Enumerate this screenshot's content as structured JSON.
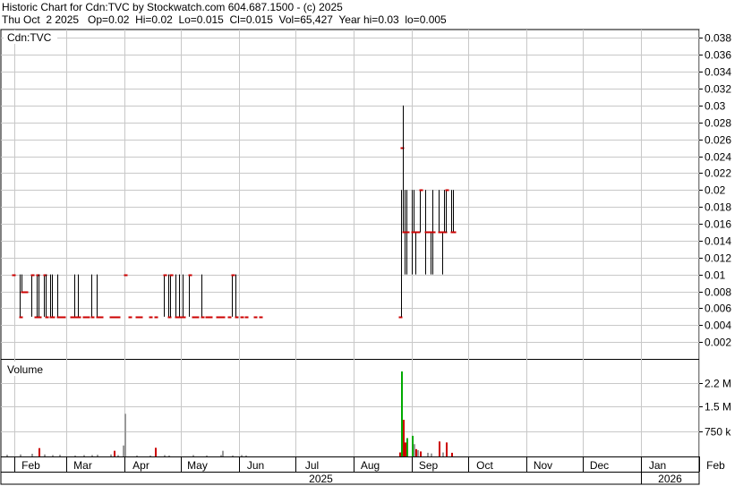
{
  "header": {
    "line1": "Historic Chart for Cdn:TVC by Stockwatch.com 604.687.1500 - (c) 2025",
    "line2": "Thu Oct  2 2025   Op=0.02  Hi=0.02  Lo=0.015  Cl=0.015  Vol=65,427  Year hi=0.03  lo=0.005"
  },
  "colors": {
    "up": "#00aa00",
    "down": "#cc0000",
    "neutral": "#999999",
    "bar": "#000000",
    "grid": "#c8c8c8"
  },
  "chart_data": [
    {
      "type": "line",
      "title": "Cdn:TVC",
      "ylim": [
        0,
        0.039
      ],
      "yticks": [
        "0.038",
        "0.036",
        "0.034",
        "0.032",
        "0.03",
        "0.028",
        "0.026",
        "0.024",
        "0.022",
        "0.02",
        "0.018",
        "0.016",
        "0.014",
        "0.012",
        "0.01",
        "0.008",
        "0.006",
        "0.004",
        "0.002"
      ],
      "series": [
        {
          "style": "hlc-bars",
          "x": [
            "2025-01-31",
            "2025-02-04",
            "2025-02-05",
            "2025-02-07",
            "2025-02-10",
            "2025-02-12",
            "2025-02-13",
            "2025-02-14",
            "2025-02-17",
            "2025-02-18",
            "2025-02-20",
            "2025-02-21",
            "2025-02-24",
            "2025-02-25",
            "2025-02-27",
            "2025-03-03",
            "2025-03-05",
            "2025-03-07",
            "2025-03-10",
            "2025-03-12",
            "2025-03-14",
            "2025-03-17",
            "2025-03-19",
            "2025-03-24",
            "2025-03-26",
            "2025-03-28",
            "2025-04-01",
            "2025-04-03",
            "2025-04-07",
            "2025-04-09",
            "2025-04-14",
            "2025-04-17",
            "2025-04-22",
            "2025-04-24",
            "2025-04-25",
            "2025-04-28",
            "2025-04-30",
            "2025-05-02",
            "2025-05-05",
            "2025-05-07",
            "2025-05-09",
            "2025-05-12",
            "2025-05-14",
            "2025-05-16",
            "2025-05-20",
            "2025-05-22",
            "2025-05-23",
            "2025-05-26",
            "2025-05-28",
            "2025-05-30",
            "2025-06-02",
            "2025-06-04",
            "2025-06-09",
            "2025-06-12",
            "2025-08-25",
            "2025-08-26",
            "2025-08-27",
            "2025-08-28",
            "2025-08-29",
            "2025-09-01",
            "2025-09-02",
            "2025-09-03",
            "2025-09-04",
            "2025-09-05",
            "2025-09-08",
            "2025-09-09",
            "2025-09-10",
            "2025-09-11",
            "2025-09-12",
            "2025-09-15",
            "2025-09-16",
            "2025-09-17",
            "2025-09-18",
            "2025-09-19",
            "2025-09-22",
            "2025-09-23"
          ],
          "high": [
            0.01,
            0.01,
            0.01,
            0.008,
            0.01,
            0.005,
            0.01,
            0.01,
            0.01,
            0.01,
            0.01,
            0.01,
            0.01,
            0.005,
            0.005,
            0.005,
            0.01,
            0.01,
            0.005,
            0.005,
            0.01,
            0.01,
            0.005,
            0.005,
            0.005,
            0.005,
            0.01,
            0.005,
            0.005,
            0.005,
            0.005,
            0.005,
            0.01,
            0.01,
            0.01,
            0.01,
            0.01,
            0.01,
            0.01,
            0.005,
            0.005,
            0.01,
            0.005,
            0.005,
            0.005,
            0.005,
            0.005,
            0.005,
            0.01,
            0.01,
            0.005,
            0.005,
            0.005,
            0.005,
            0.005,
            0.02,
            0.03,
            0.02,
            0.02,
            0.02,
            0.02,
            0.015,
            0.015,
            0.02,
            0.02,
            0.015,
            0.015,
            0.015,
            0.02,
            0.02,
            0.015,
            0.015,
            0.02,
            0.02,
            0.02,
            0.02
          ],
          "low": [
            0.01,
            0.005,
            0.008,
            0.008,
            0.005,
            0.005,
            0.005,
            0.005,
            0.005,
            0.005,
            0.005,
            0.005,
            0.005,
            0.005,
            0.005,
            0.005,
            0.005,
            0.005,
            0.005,
            0.005,
            0.005,
            0.005,
            0.005,
            0.005,
            0.005,
            0.005,
            0.01,
            0.005,
            0.005,
            0.005,
            0.005,
            0.005,
            0.005,
            0.005,
            0.005,
            0.005,
            0.005,
            0.005,
            0.005,
            0.005,
            0.005,
            0.005,
            0.005,
            0.005,
            0.005,
            0.005,
            0.005,
            0.005,
            0.005,
            0.005,
            0.005,
            0.005,
            0.005,
            0.005,
            0.005,
            0.005,
            0.015,
            0.01,
            0.01,
            0.01,
            0.015,
            0.01,
            0.015,
            0.015,
            0.01,
            0.015,
            0.015,
            0.01,
            0.01,
            0.015,
            0.015,
            0.01,
            0.015,
            0.015,
            0.015,
            0.015
          ],
          "close": [
            0.01,
            0.005,
            0.008,
            0.008,
            0.01,
            0.005,
            0.01,
            0.005,
            0.01,
            0.005,
            0.005,
            0.005,
            0.005,
            0.005,
            0.005,
            0.005,
            0.005,
            0.005,
            0.005,
            0.005,
            0.005,
            0.005,
            0.005,
            0.005,
            0.005,
            0.005,
            0.01,
            0.005,
            0.005,
            0.005,
            0.005,
            0.005,
            0.01,
            0.005,
            0.01,
            0.005,
            0.005,
            0.005,
            0.01,
            0.005,
            0.005,
            0.005,
            0.005,
            0.005,
            0.005,
            0.005,
            0.005,
            0.005,
            0.01,
            0.005,
            0.005,
            0.005,
            0.005,
            0.005,
            0.005,
            0.025,
            0.015,
            0.015,
            0.015,
            0.015,
            0.015,
            0.015,
            0.015,
            0.02,
            0.015,
            0.015,
            0.015,
            0.015,
            0.015,
            0.015,
            0.015,
            0.015,
            0.015,
            0.02,
            0.015,
            0.015
          ]
        }
      ]
    },
    {
      "type": "bar",
      "title": "Volume",
      "ylim": [
        0,
        2900000
      ],
      "yticks": [
        {
          "value": 2200000,
          "label": "2.2 M"
        },
        {
          "value": 1500000,
          "label": "1.5 M"
        },
        {
          "value": 750000,
          "label": "750 k"
        }
      ],
      "xlim": [
        "2025-01-25",
        "2026-02-01"
      ],
      "xticks": [
        {
          "date": "2025-02-01",
          "label": "Feb"
        },
        {
          "date": "2025-03-01",
          "label": "Mar"
        },
        {
          "date": "2025-04-01",
          "label": "Apr"
        },
        {
          "date": "2025-05-01",
          "label": "May"
        },
        {
          "date": "2025-06-01",
          "label": "Jun"
        },
        {
          "date": "2025-07-01",
          "label": "Jul"
        },
        {
          "date": "2025-08-01",
          "label": "Aug"
        },
        {
          "date": "2025-09-01",
          "label": "Sep"
        },
        {
          "date": "2025-10-01",
          "label": "Oct"
        },
        {
          "date": "2025-11-01",
          "label": "Nov"
        },
        {
          "date": "2025-12-01",
          "label": "Dec"
        },
        {
          "date": "2026-01-01",
          "label": "Jan"
        },
        {
          "date": "2026-02-01",
          "label": "Feb"
        }
      ],
      "year_labels": [
        {
          "start": "2025-01-25",
          "end": "2026-01-01",
          "label": "2025"
        },
        {
          "start": "2026-01-01",
          "end": "2026-02-01",
          "label": "2026"
        }
      ],
      "series": [
        {
          "x": [
            "2025-01-28",
            "2025-02-04",
            "2025-02-10",
            "2025-02-14",
            "2025-02-17",
            "2025-02-21",
            "2025-02-25",
            "2025-03-05",
            "2025-03-10",
            "2025-03-14",
            "2025-03-17",
            "2025-03-24",
            "2025-03-26",
            "2025-03-28",
            "2025-03-31",
            "2025-04-01",
            "2025-04-07",
            "2025-04-14",
            "2025-04-17",
            "2025-04-22",
            "2025-04-24",
            "2025-05-07",
            "2025-05-14",
            "2025-05-22",
            "2025-05-23",
            "2025-05-28",
            "2025-06-02",
            "2025-06-04",
            "2025-08-25",
            "2025-08-26",
            "2025-08-27",
            "2025-08-28",
            "2025-08-29",
            "2025-09-01",
            "2025-09-02",
            "2025-09-03",
            "2025-09-04",
            "2025-09-05",
            "2025-09-09",
            "2025-09-11",
            "2025-09-15",
            "2025-09-17",
            "2025-09-19",
            "2025-09-22"
          ],
          "values": [
            50000,
            60000,
            80000,
            250000,
            60000,
            40000,
            50000,
            30000,
            40000,
            40000,
            50000,
            60000,
            170000,
            40000,
            330000,
            1280000,
            30000,
            30000,
            260000,
            40000,
            30000,
            40000,
            30000,
            40000,
            170000,
            30000,
            40000,
            30000,
            120000,
            2550000,
            1100000,
            420000,
            550000,
            620000,
            370000,
            220000,
            190000,
            150000,
            110000,
            90000,
            450000,
            120000,
            420000,
            110000
          ],
          "colors": [
            "neutral",
            "neutral",
            "neutral",
            "down",
            "neutral",
            "neutral",
            "neutral",
            "neutral",
            "neutral",
            "neutral",
            "neutral",
            "neutral",
            "down",
            "neutral",
            "neutral",
            "neutral",
            "neutral",
            "neutral",
            "down",
            "neutral",
            "neutral",
            "neutral",
            "neutral",
            "neutral",
            "neutral",
            "neutral",
            "neutral",
            "neutral",
            "down",
            "up",
            "down",
            "down",
            "up",
            "up",
            "neutral",
            "down",
            "neutral",
            "down",
            "neutral",
            "neutral",
            "down",
            "neutral",
            "down",
            "down"
          ]
        }
      ]
    }
  ]
}
